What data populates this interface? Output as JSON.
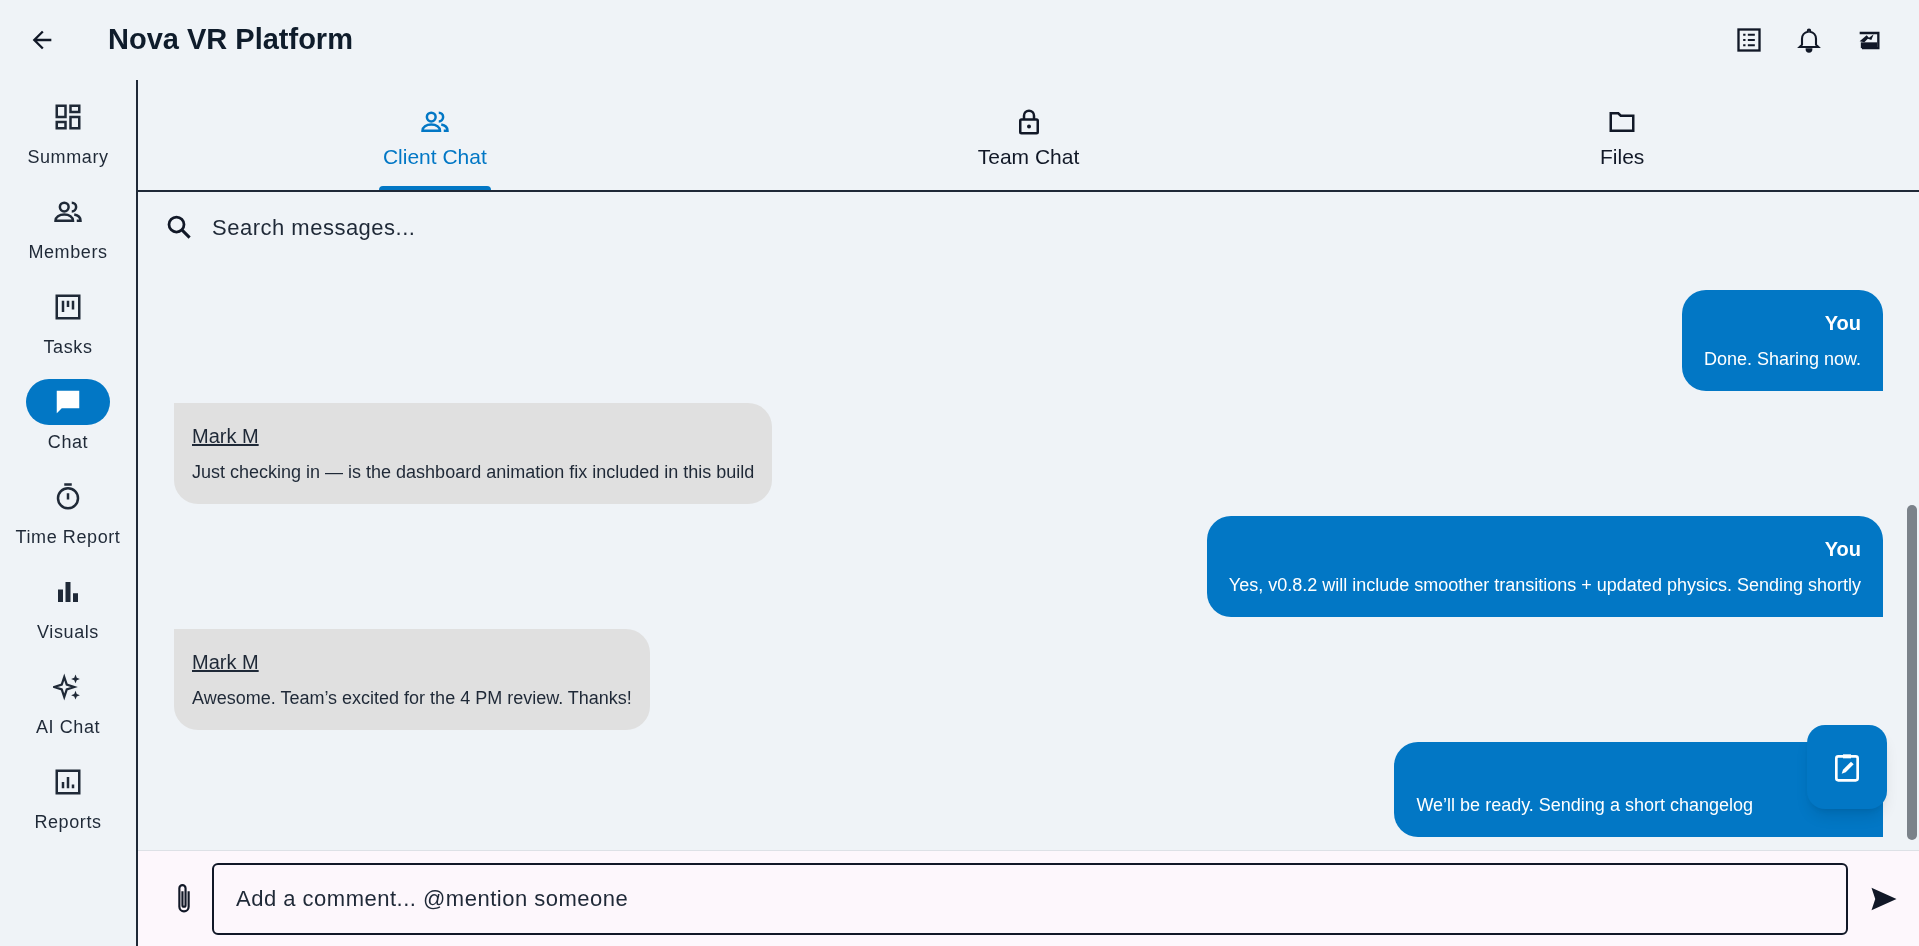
{
  "header": {
    "title": "Nova VR Platform"
  },
  "sidebar": {
    "items": [
      {
        "label": "Summary",
        "selected": false
      },
      {
        "label": "Members",
        "selected": false
      },
      {
        "label": "Tasks",
        "selected": false
      },
      {
        "label": "Chat",
        "selected": true
      },
      {
        "label": "Time Report",
        "selected": false
      },
      {
        "label": "Visuals",
        "selected": false
      },
      {
        "label": "AI Chat",
        "selected": false
      },
      {
        "label": "Reports",
        "selected": false
      }
    ]
  },
  "tabs": [
    {
      "label": "Client Chat",
      "selected": true
    },
    {
      "label": "Team Chat",
      "selected": false
    },
    {
      "label": "Files",
      "selected": false
    }
  ],
  "search": {
    "placeholder": "Search messages..."
  },
  "messages": [
    {
      "kind": "own",
      "sender": "You",
      "text": "Done. Sharing now."
    },
    {
      "kind": "other",
      "sender": "Mark M",
      "text": "Just checking in — is the dashboard animation fix included in this build"
    },
    {
      "kind": "own",
      "sender": "You",
      "text": "Yes, v0.8.2 will include smoother transitions + updated physics. Sending shortly"
    },
    {
      "kind": "other",
      "sender": "Mark M",
      "text": "Awesome. Team’s excited for the 4 PM review. Thanks!"
    },
    {
      "kind": "own",
      "text": "We’ll be ready. Sending a short changelog"
    }
  ],
  "composer": {
    "placeholder": "Add a comment... @mention someone"
  }
}
